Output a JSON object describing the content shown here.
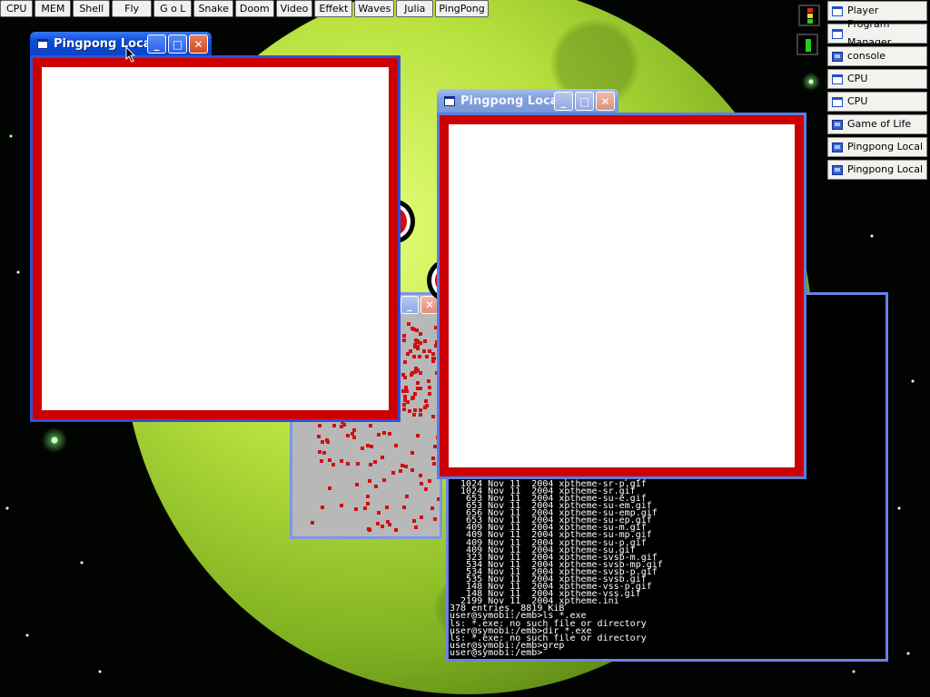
{
  "launcher": {
    "items": [
      "CPU",
      "MEM",
      "Shell",
      "Fly",
      "G o L",
      "Snake",
      "Doom",
      "Video",
      "Effekt",
      "Waves",
      "Julia",
      "PingPong"
    ]
  },
  "tasklist": {
    "items": [
      {
        "label": "Player",
        "icon": "window-icon"
      },
      {
        "label": "Program Manager",
        "icon": "window-icon"
      },
      {
        "label": "console",
        "icon": "computer-icon"
      },
      {
        "label": "CPU",
        "icon": "window-icon"
      },
      {
        "label": "CPU",
        "icon": "window-icon"
      },
      {
        "label": "Game of Life",
        "icon": "computer-icon"
      },
      {
        "label": "Pingpong Local",
        "icon": "computer-icon"
      },
      {
        "label": "Pingpong Local",
        "icon": "computer-icon"
      }
    ]
  },
  "windows": {
    "pingpong1": {
      "title": "Pingpong Local"
    },
    "pingpong2": {
      "title": "Pingpong Local"
    }
  },
  "console": {
    "lines": [
      "  1024 Nov 11  2004 xptheme-sr-mp.gif",
      "  1024 Nov 11  2004 xptheme-sr-p.gif",
      "  1024 Nov 11  2004 xptheme-sr.gif",
      "   653 Nov 11  2004 xptheme-su-e.gif",
      "   653 Nov 11  2004 xptheme-su-em.gif",
      "   656 Nov 11  2004 xptheme-su-emp.gif",
      "   653 Nov 11  2004 xptheme-su-ep.gif",
      "   409 Nov 11  2004 xptheme-su-m.gif",
      "   409 Nov 11  2004 xptheme-su-mp.gif",
      "   409 Nov 11  2004 xptheme-su-p.gif",
      "   409 Nov 11  2004 xptheme-su.gif",
      "   323 Nov 11  2004 xptheme-svsb-m.gif",
      "   534 Nov 11  2004 xptheme-svsb-mp.gif",
      "   534 Nov 11  2004 xptheme-svsb-p.gif",
      "   535 Nov 11  2004 xptheme-svsb.gif",
      "   148 Nov 11  2004 xptheme-vss-p.gif",
      "   148 Nov 11  2004 xptheme-vss.gif",
      "  2199 Nov 11  2004 xptheme.ini",
      "378 entries, 8819 KiB",
      "user@symobi:/emb>ls *.exe",
      "ls: *.exe: no such file or directory",
      "user@symobi:/emb>dir *.exe",
      "ls: *.exe: no such file or directory",
      "user@symobi:/emb>grep",
      "user@symobi:/emb>"
    ]
  },
  "colors": {
    "court": "#ffffff",
    "court_border": "#cc0000",
    "titlebar_active": "#0a4fd8",
    "titlebar_inactive": "#7f9fdf",
    "console_bg": "#000000",
    "gol_bg": "#b8b8b8",
    "gol_cell": "#d01010"
  }
}
